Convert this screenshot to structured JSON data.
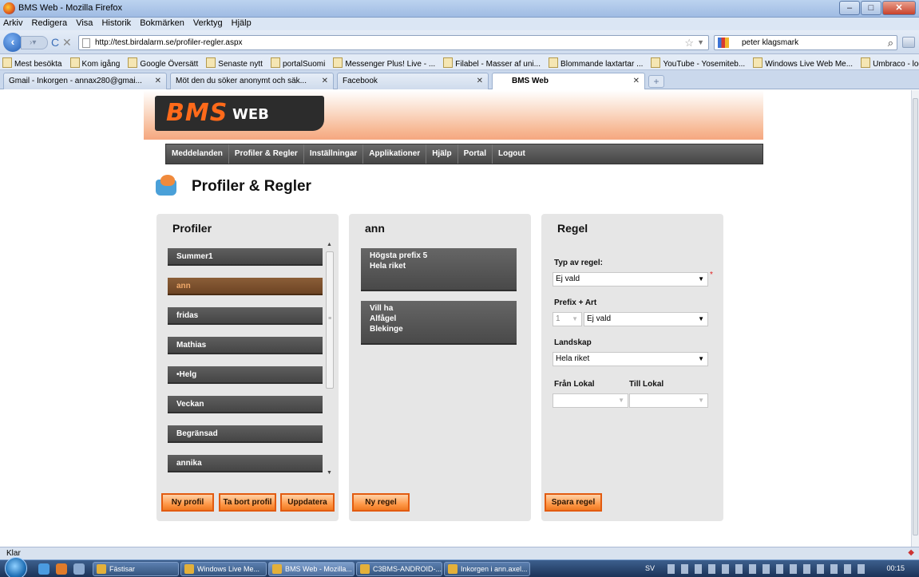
{
  "window": {
    "title": "BMS Web - Mozilla Firefox",
    "controls": [
      "–",
      "□",
      "✕"
    ]
  },
  "menubar": [
    "Arkiv",
    "Redigera",
    "Visa",
    "Historik",
    "Bokmärken",
    "Verktyg",
    "Hjälp"
  ],
  "navbar": {
    "url": "http://test.birdalarm.se/profiler-regler.aspx",
    "search_value": "peter klagsmark"
  },
  "bookmarks": [
    "Mest besökta",
    "Kom igång",
    "Google Översätt",
    "Senaste nytt",
    "portalSuomi",
    "Messenger Plus! Live - ...",
    "Filabel - Masser af uni...",
    "Blommande laxtartar ...",
    "YouTube - Yosemiteb...",
    "Windows Live Web Me...",
    "Umbraco - login"
  ],
  "tabs": [
    {
      "label": "Gmail - Inkorgen - annax280@gmai...",
      "active": false
    },
    {
      "label": "Möt den du söker anonymt och säk...",
      "active": false
    },
    {
      "label": "Facebook",
      "active": false
    },
    {
      "label": "BMS Web",
      "active": true
    }
  ],
  "site": {
    "logo_main": "BMS",
    "logo_sub": "WEB",
    "nav": [
      "Meddelanden",
      "Profiler & Regler",
      "Inställningar",
      "Applikationer",
      "Hjälp",
      "Portal",
      "Logout"
    ],
    "page_title": "Profiler & Regler"
  },
  "profiles_panel": {
    "title": "Profiler",
    "items": [
      {
        "label": "Summer1",
        "selected": false
      },
      {
        "label": "ann",
        "selected": true
      },
      {
        "label": "fridas",
        "selected": false
      },
      {
        "label": "Mathias",
        "selected": false
      },
      {
        "label": "•Helg",
        "selected": false
      },
      {
        "label": "Veckan",
        "selected": false
      },
      {
        "label": "Begränsad",
        "selected": false
      },
      {
        "label": "annika",
        "selected": false
      }
    ],
    "buttons": {
      "new": "Ny profil",
      "delete": "Ta bort profil",
      "update": "Uppdatera"
    }
  },
  "rules_panel": {
    "title": "ann",
    "rules": [
      {
        "line1": "Högsta prefix 5",
        "line2": "Hela riket",
        "line3": ""
      },
      {
        "line1": "Vill ha",
        "line2": "Alfågel",
        "line3": "Blekinge"
      }
    ],
    "new_button": "Ny regel"
  },
  "rule_panel": {
    "title": "Regel",
    "type_label": "Typ av regel:",
    "type_value": "Ej vald",
    "type_required": "*",
    "prefix_label": "Prefix + Art",
    "prefix_value": "1",
    "species_value": "Ej vald",
    "region_label": "Landskap",
    "region_value": "Hela riket",
    "from_label": "Från Lokal",
    "to_label": "Till Lokal",
    "from_value": "",
    "to_value": "",
    "save_button": "Spara regel"
  },
  "statusbar": {
    "text": "Klar"
  },
  "taskbar": {
    "tasks": [
      "Fästisar",
      "Windows Live Me...",
      "BMS Web - Mozilla...",
      "C3BMS-ANDROID-...",
      "Inkorgen i ann.axel..."
    ],
    "language": "SV",
    "clock": "00:15"
  }
}
